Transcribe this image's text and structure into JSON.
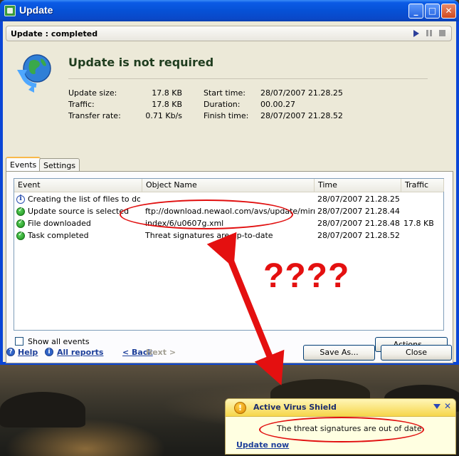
{
  "window": {
    "title": "Update"
  },
  "status": {
    "text": "Update : completed",
    "controls": [
      "play-icon",
      "pause-icon",
      "stop-icon"
    ]
  },
  "summary": {
    "headline": "Update is not required",
    "left": [
      {
        "label": "Update size:",
        "value": "17.8 KB"
      },
      {
        "label": "Traffic:",
        "value": "17.8 KB"
      },
      {
        "label": "Transfer rate:",
        "value": "0.71 Kb/s"
      }
    ],
    "right": [
      {
        "label": "Start time:",
        "value": "28/07/2007 21.28.25"
      },
      {
        "label": "Duration:",
        "value": "00.00.27"
      },
      {
        "label": "Finish time:",
        "value": "28/07/2007 21.28.52"
      }
    ]
  },
  "tabs": [
    {
      "label": "Events",
      "selected": true
    },
    {
      "label": "Settings",
      "selected": false
    }
  ],
  "events": {
    "columns": [
      "Event",
      "Object Name",
      "Time",
      "Traffic"
    ],
    "rows": [
      {
        "icon": "info-icon",
        "event": "Creating the list of files to do...",
        "object": "",
        "time": "28/07/2007 21.28.25",
        "traffic": ""
      },
      {
        "icon": "check-icon",
        "event": "Update source is selected",
        "object": "ftp://download.newaol.com/avs/update/mirror/",
        "time": "28/07/2007 21.28.44",
        "traffic": ""
      },
      {
        "icon": "check-icon",
        "event": "File downloaded",
        "object": "index/6/u0607g.xml",
        "time": "28/07/2007 21.28.48",
        "traffic": "17.8 KB"
      },
      {
        "icon": "check-icon",
        "event": "Task completed",
        "object": "Threat signatures are up-to-date",
        "time": "28/07/2007 21.28.52",
        "traffic": ""
      }
    ],
    "show_all_label": "Show all events",
    "show_all_checked": false,
    "actions_label": "Actions..."
  },
  "footer": {
    "help": "Help",
    "all_reports": "All reports",
    "back": "< Back",
    "next": "Next >",
    "save_as": "Save As...",
    "close": "Close"
  },
  "annotation": {
    "question_marks": "????",
    "color": "#e41010"
  },
  "popup": {
    "title": "Active Virus Shield",
    "message": "The threat signatures are out of date.",
    "link": "Update now"
  },
  "colors": {
    "accent": "#0a46d6",
    "link": "#1d3f9a",
    "success": "#1b8c1b",
    "popup_bg": "#ffffe1"
  }
}
